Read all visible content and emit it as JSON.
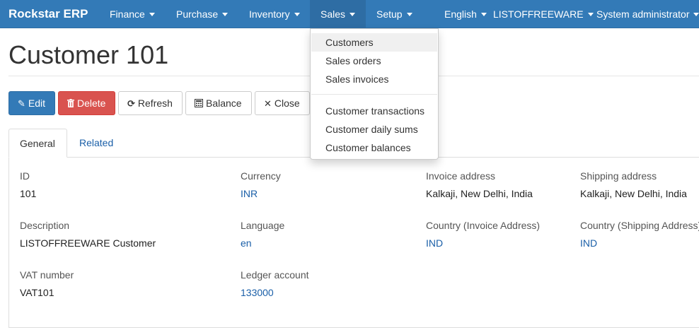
{
  "navbar": {
    "brand": "Rockstar ERP",
    "menus": [
      "Finance",
      "Purchase",
      "Inventory",
      "Sales",
      "Setup"
    ],
    "language": "English",
    "company": "LISTOFFREEWARE",
    "user": "System administrator"
  },
  "sales_menu": {
    "items": [
      "Customers",
      "Sales orders",
      "Sales invoices"
    ],
    "items2": [
      "Customer transactions",
      "Customer daily sums",
      "Customer balances"
    ]
  },
  "page": {
    "title": "Customer 101"
  },
  "toolbar": {
    "edit": "Edit",
    "delete": "Delete",
    "refresh": "Refresh",
    "balance": "Balance",
    "close": "Close"
  },
  "tabs": {
    "general": "General",
    "related": "Related"
  },
  "fields": {
    "id_label": "ID",
    "id_value": "101",
    "description_label": "Description",
    "description_value": "LISTOFFREEWARE Customer",
    "vat_label": "VAT number",
    "vat_value": "VAT101",
    "currency_label": "Currency",
    "currency_value": "INR",
    "language_label": "Language",
    "language_value": "en",
    "ledger_label": "Ledger account",
    "ledger_value": "133000",
    "invoice_address_label": "Invoice address",
    "invoice_address_value": "Kalkaji, New Delhi, India",
    "country_invoice_label": "Country (Invoice Address)",
    "country_invoice_value": "IND",
    "shipping_address_label": "Shipping address",
    "shipping_address_value": "Kalkaji, New Delhi, India",
    "country_shipping_label": "Country (Shipping Address)",
    "country_shipping_value": "IND"
  },
  "colors": {
    "navbar": "#337ab7",
    "primary": "#337ab7",
    "danger": "#d9534f",
    "link": "#1a5fa8"
  },
  "icons": {
    "edit": "pencil-icon",
    "delete": "trash-icon",
    "refresh": "refresh-icon",
    "balance": "calculator-icon",
    "close": "close-icon"
  }
}
